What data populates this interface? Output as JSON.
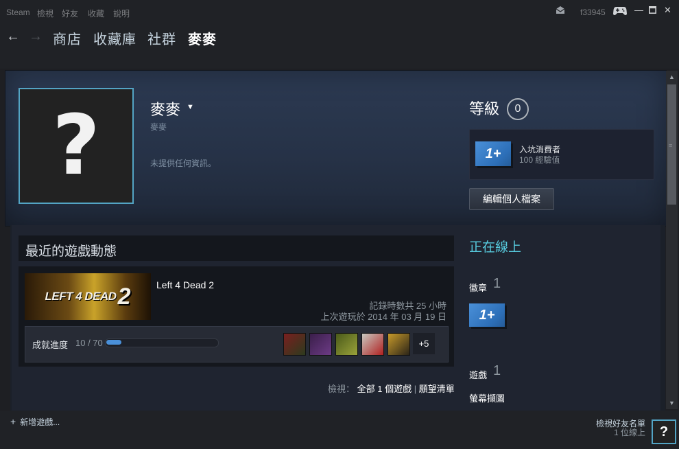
{
  "topbar": {
    "menu": [
      "Steam",
      "檢視",
      "好友",
      "收藏",
      "說明"
    ],
    "username": "f33945",
    "icons": [
      "mail-icon",
      "gamepad-icon",
      "minimize-icon",
      "maximize-icon",
      "close-icon"
    ]
  },
  "nav": {
    "back_arrow": "←",
    "forward_arrow": "→",
    "links": [
      "商店",
      "收藏庫",
      "社群",
      "麥麥"
    ]
  },
  "profile": {
    "avatar_placeholder": "?",
    "name": "麥麥",
    "real_name": "麥麥",
    "summary": "未提供任何資訊。",
    "level_label": "等級",
    "level_value": "0",
    "level_badge_icon": "1+",
    "level_badge_name": "入坑消費者",
    "level_badge_xp": "100 經驗值",
    "edit_button": "編輯個人檔案"
  },
  "recent": {
    "title": "最近的遊戲動態",
    "game": {
      "capsule_text_a": "LEFT 4 DEAD",
      "capsule_text_b": "2",
      "name": "Left 4 Dead 2",
      "hours": "記錄時數共 25 小時",
      "last_played": "上次遊玩於 2014 年 03 月 19 日",
      "achievements_label": "成就進度",
      "achievements_count": "10 / 70",
      "achievements_progress": 0.14,
      "achievement_icons": [
        {
          "name": "achievement-icon-1",
          "colors": [
            "#7a1f1f",
            "#2c3b1e"
          ]
        },
        {
          "name": "achievement-icon-2",
          "colors": [
            "#3a1e4a",
            "#6c3b85"
          ]
        },
        {
          "name": "achievement-icon-3",
          "colors": [
            "#4a5a1a",
            "#9aa23a"
          ]
        },
        {
          "name": "achievement-icon-4",
          "colors": [
            "#c8c8c0",
            "#b02020"
          ]
        },
        {
          "name": "achievement-icon-5",
          "colors": [
            "#c79a2a",
            "#2b2418"
          ]
        }
      ],
      "achievements_more": "+5"
    },
    "view_prefix": "檢視：",
    "view_all": "全部 1 個遊戲",
    "view_separator": "|",
    "view_wishlist": "願望清單"
  },
  "sidebar": {
    "online_status": "正在線上",
    "badges_label": "徽章",
    "badges_count": "1",
    "badge_icon": "1+",
    "games_label": "遊戲",
    "games_count": "1",
    "screenshots_label": "螢幕擷圖"
  },
  "bottombar": {
    "add_game_icon": "+",
    "add_game": "新增遊戲...",
    "friends_list": "檢視好友名單",
    "friends_online": "1 位線上",
    "friend_avatar": "?"
  },
  "colors": {
    "accent_blue": "#57cbde",
    "avatar_border": "#53a4c4",
    "badge_blue": "#4a90d9"
  }
}
